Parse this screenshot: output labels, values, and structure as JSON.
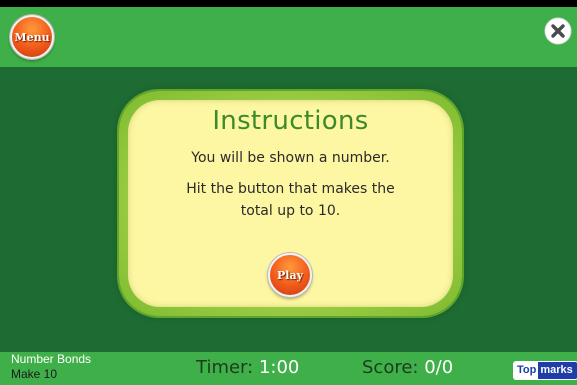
{
  "header": {
    "menu_label": "Menu"
  },
  "instructions": {
    "title": "Instructions",
    "line1": "You will be shown a number.",
    "line2a": "Hit the button that makes the",
    "line2b": "total up to 10.",
    "play_label": "Play"
  },
  "footer": {
    "game_name": "Number Bonds",
    "game_subtitle": "Make 10",
    "timer_label": "Timer:",
    "timer_value": "1:00",
    "score_label": "Score:",
    "score_value": "0/0",
    "logo_part1": "Top",
    "logo_part2": "marks"
  },
  "icons": {
    "close": "close-icon"
  },
  "colors": {
    "bar_green": "#3fb049",
    "board_green": "#1e6b33",
    "panel_yellow": "#fdf6a2",
    "title_green": "#3d8a2b",
    "button_orange": "#f2591b"
  }
}
